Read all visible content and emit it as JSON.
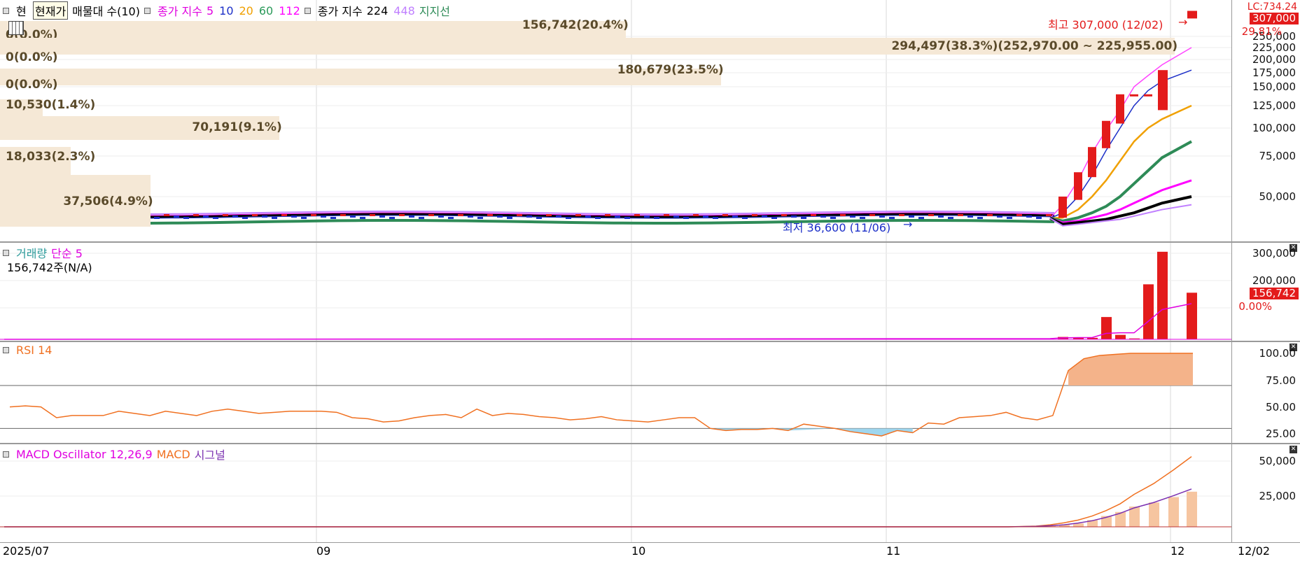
{
  "price_legend": {
    "tab_left": "현",
    "tab_title": "현재가",
    "sell_label": "매물대 수(10)",
    "ma_label": "종가 지수",
    "ma_periods": [
      "5",
      "10",
      "20",
      "60",
      "112"
    ],
    "ma_colors": [
      "#e000e0",
      "#1c2fc8",
      "#f0a000",
      "#2b9a5a",
      "#ff00ff"
    ],
    "ma2_label": "종가 지수",
    "ma2_periods": [
      "224",
      "448"
    ],
    "ma2_colors": [
      "#000000",
      "#c080ff"
    ],
    "support_label": "지지선",
    "support_color": "#2e8b57"
  },
  "price_axis": {
    "ticks": [
      "250,000",
      "225,000",
      "200,000",
      "175,000",
      "150,000",
      "125,000",
      "100,000",
      "75,000",
      "50,000"
    ],
    "current_tag": "307,000",
    "change_pct": "29.81%",
    "top_label": "LC:734.24"
  },
  "annotations": {
    "high": "최고 307,000 (12/02)",
    "low": "최저 36,600 (11/06)"
  },
  "volume_profile": [
    {
      "label": "156,742(20.4%)",
      "pct": 20.4
    },
    {
      "label": "0(0.0%)",
      "pct": 0
    },
    {
      "label": "294,497(38.3%)(252,970.00 ~ 225,955.00)",
      "pct": 38.3
    },
    {
      "label": "0(0.0%)",
      "pct": 0
    },
    {
      "label": "180,679(23.5%)",
      "pct": 23.5
    },
    {
      "label": "0(0.0%)",
      "pct": 0
    },
    {
      "label": "10,530(1.4%)",
      "pct": 1.4
    },
    {
      "label": "70,191(9.1%)",
      "pct": 9.1
    },
    {
      "label": "18,033(2.3%)",
      "pct": 2.3
    },
    {
      "label": "37,506(4.9%)",
      "pct": 4.9
    }
  ],
  "volume_legend": {
    "label": "거래량",
    "ma": "단순 5",
    "value": "156,742주(N/A)"
  },
  "volume_axis": {
    "ticks": [
      "300,000",
      "200,000"
    ],
    "current_tag": "156,742",
    "pct_tag": "0.00%"
  },
  "rsi_legend": {
    "label": "RSI 14"
  },
  "rsi_axis": {
    "ticks": [
      "100.00",
      "75.00",
      "50.00",
      "25.00"
    ]
  },
  "macd_legend": {
    "label": "MACD Oscillator 12,26,9",
    "macd": "MACD",
    "signal": "시그널"
  },
  "macd_axis": {
    "ticks": [
      "50,000",
      "25,000"
    ]
  },
  "x_axis": {
    "labels": [
      "2025/07",
      "09",
      "10",
      "11",
      "12"
    ],
    "right_label": "12/02"
  },
  "chart_data": [
    {
      "type": "bar",
      "title": "",
      "panel": "price-candles",
      "x": [
        "11/20",
        "11/21",
        "11/24",
        "11/25",
        "11/26",
        "11/27",
        "11/28",
        "12/01",
        "12/02"
      ],
      "open": [
        37000,
        48000,
        62000,
        82000,
        105000,
        140000,
        140000,
        180000,
        290000
      ],
      "close": [
        50000,
        65000,
        83000,
        108000,
        140000,
        140000,
        140000,
        120000,
        307000
      ],
      "ylim": [
        30000,
        320000
      ]
    },
    {
      "type": "bar",
      "panel": "volume",
      "x": [
        "11/20",
        "11/21",
        "11/24",
        "11/25",
        "11/26",
        "11/27",
        "11/28",
        "12/01",
        "12/02"
      ],
      "values": [
        8000,
        6000,
        5000,
        75000,
        15000,
        3000,
        185000,
        294497,
        156742
      ],
      "ylim": [
        0,
        320000
      ]
    },
    {
      "type": "line",
      "panel": "rsi",
      "values": [
        50,
        51,
        50,
        40,
        42,
        42,
        42,
        46,
        44,
        42,
        46,
        44,
        42,
        46,
        48,
        46,
        44,
        45,
        46,
        46,
        46,
        45,
        40,
        39,
        36,
        37,
        40,
        42,
        43,
        40,
        48,
        42,
        44,
        43,
        41,
        40,
        38,
        39,
        41,
        38,
        37,
        36,
        38,
        40,
        40,
        30,
        28,
        29,
        29,
        30,
        28,
        34,
        32,
        30,
        27,
        25,
        23,
        28,
        26,
        35,
        34,
        40,
        41,
        42,
        45,
        40,
        38,
        42,
        84,
        95,
        98,
        99,
        100,
        100,
        100,
        100,
        100
      ],
      "ylim": [
        20,
        100
      ]
    },
    {
      "type": "bar",
      "panel": "macd",
      "values": [
        800,
        1200,
        1500,
        2500,
        5000,
        8000,
        11000,
        15000,
        18000,
        22000,
        26000
      ],
      "macd_line": [
        500,
        1500,
        3000,
        5000,
        8000,
        12000,
        17000,
        24000,
        32000,
        42000,
        52000
      ],
      "signal_line": [
        300,
        800,
        1500,
        2800,
        4500,
        7000,
        10000,
        14000,
        18000,
        23000,
        28000
      ],
      "ylim": [
        0,
        58000
      ]
    }
  ]
}
